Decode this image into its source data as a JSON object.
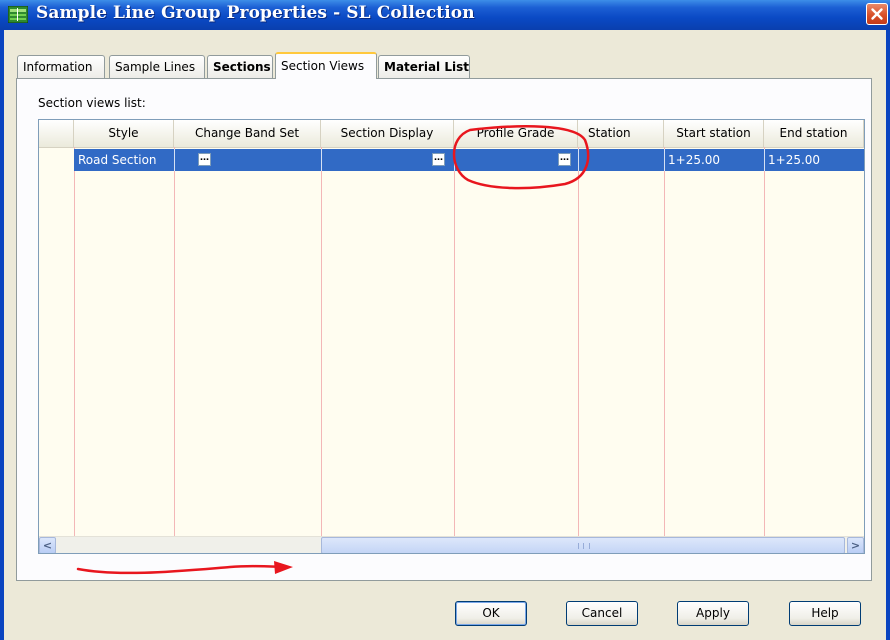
{
  "window": {
    "title": "Sample Line Group Properties - SL Collection",
    "close_glyph": "✕"
  },
  "tabs": [
    {
      "label": "Information"
    },
    {
      "label": "Sample Lines"
    },
    {
      "label": "Sections"
    },
    {
      "label": "Section Views"
    },
    {
      "label": "Material List"
    }
  ],
  "active_tab": "Section Views",
  "section_views": {
    "list_label": "Section views list:",
    "columns": [
      "Style",
      "Change Band Set",
      "Section Display",
      "Profile Grade",
      "Station",
      "Start station",
      "End station"
    ],
    "rows": [
      {
        "style": "Road Section",
        "station": "",
        "start_station": "1+25.00",
        "end_station": "1+25.00"
      }
    ],
    "ellipsis_glyph": "…"
  },
  "scrollbar": {
    "left_arrow": "<",
    "right_arrow": ">"
  },
  "buttons": {
    "ok": "OK",
    "cancel": "Cancel",
    "apply": "Apply",
    "help": "Help"
  },
  "colors": {
    "selection": "#316ac5",
    "annotation": "#e8161e",
    "titlebar": "#0a49c4"
  }
}
